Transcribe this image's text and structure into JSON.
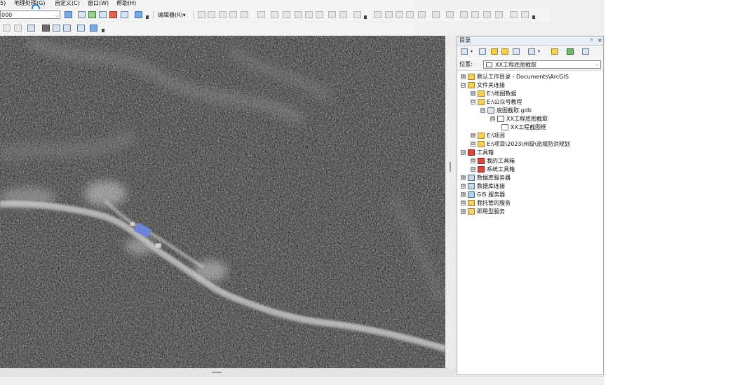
{
  "menubar": {
    "items": [
      "5)",
      "地理处理(G)",
      "自定义(C)",
      "窗口(W)",
      "帮助(H)"
    ]
  },
  "toolbar": {
    "scale_value": "000",
    "editor_label": "编辑器(R)▾"
  },
  "catalog": {
    "title": "目录",
    "pin": "ᵖ",
    "close": "×",
    "location_label": "位置:",
    "location_value": "XX工程底图截取",
    "tree": [
      {
        "expander": "⊞",
        "icon": "folder",
        "label": "默认工作目录 - Documents\\ArcGIS"
      },
      {
        "expander": "⊟",
        "icon": "conn",
        "label": "文件夹连接"
      },
      {
        "expander": "⊞",
        "icon": "folder",
        "label": "E:\\地图数据"
      },
      {
        "expander": "⊟",
        "icon": "folder",
        "label": "E:\\公众号教程"
      },
      {
        "expander": "⊟",
        "icon": "gdb",
        "label": "底图截取.gdb"
      },
      {
        "expander": "⊟",
        "icon": "fds",
        "label": "XX工程底图截取"
      },
      {
        "expander": "",
        "icon": "fc",
        "label": "XX工程截图框"
      },
      {
        "expander": "⊞",
        "icon": "folder",
        "label": "E:\\项目"
      },
      {
        "expander": "⊞",
        "icon": "folder",
        "label": "E:\\项目\\2023\\州级\\流域防洪规划"
      },
      {
        "expander": "⊟",
        "icon": "tbox",
        "label": "工具箱"
      },
      {
        "expander": "⊞",
        "icon": "tbox",
        "label": "我的工具箱"
      },
      {
        "expander": "⊞",
        "icon": "tbox",
        "label": "系统工具箱"
      },
      {
        "expander": "⊞",
        "icon": "db",
        "label": "数据库服务器"
      },
      {
        "expander": "⊞",
        "icon": "db",
        "label": "数据库连接"
      },
      {
        "expander": "⊞",
        "icon": "gis",
        "label": "GIS 服务器"
      },
      {
        "expander": "⊞",
        "icon": "svc",
        "label": "我托管的服务"
      },
      {
        "expander": "⊞",
        "icon": "svc",
        "label": "即用型服务"
      }
    ]
  }
}
